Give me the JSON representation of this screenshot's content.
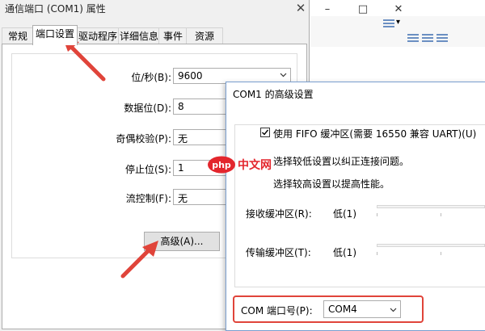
{
  "background_window": {
    "controls": [
      "–",
      "□",
      "✕"
    ],
    "ribbon_dropdown": "▾"
  },
  "main_dialog": {
    "title": "通信端口 (COM1) 属性",
    "close_glyph": "✕",
    "tabs": [
      {
        "label": "常规",
        "active": false
      },
      {
        "label": "端口设置",
        "active": true
      },
      {
        "label": "驱动程序",
        "active": false
      },
      {
        "label": "详细信息",
        "active": false
      },
      {
        "label": "事件",
        "active": false
      },
      {
        "label": "资源",
        "active": false
      }
    ],
    "fields": [
      {
        "label": "位/秒(B):",
        "value": "9600"
      },
      {
        "label": "数据位(D):",
        "value": "8"
      },
      {
        "label": "奇偶校验(P):",
        "value": "无"
      },
      {
        "label": "停止位(S):",
        "value": "1"
      },
      {
        "label": "流控制(F):",
        "value": "无"
      }
    ],
    "advanced_button": "高级(A)..."
  },
  "advanced_dialog": {
    "title": "COM1 的高级设置",
    "fifo_checkbox_label": "使用 FIFO 缓冲区(需要 16550 兼容 UART)(U)",
    "fifo_checked": true,
    "hint_low": "选择较低设置以纠正连接问题。",
    "hint_high": "选择较高设置以提高性能。",
    "receive_label": "接收缓冲区(R):",
    "receive_value": "低(1)",
    "transmit_label": "传输缓冲区(T):",
    "transmit_value": "低(1)",
    "com_port_label": "COM 端口号(P):",
    "com_port_value": "COM4"
  },
  "watermark": {
    "text": "中文网",
    "logo_letters": "php"
  },
  "colors": {
    "highlight": "#e0443a",
    "watermark_red": "#e3262d",
    "title_accent": "#7a9fd0"
  }
}
